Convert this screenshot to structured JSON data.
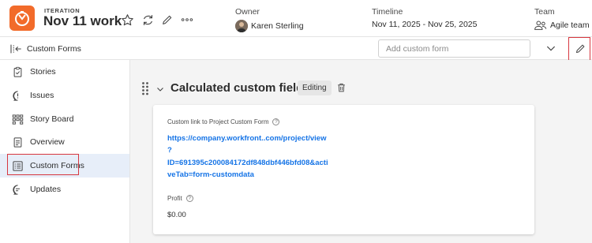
{
  "header": {
    "kicker": "ITERATION",
    "title": "Nov 11 work",
    "owner_label": "Owner",
    "owner_value": "Karen Sterling",
    "timeline_label": "Timeline",
    "timeline_value": "Nov 11, 2025 - Nov 25, 2025",
    "team_label": "Team",
    "team_value": "Agile team",
    "brand_color": "#f26b2a"
  },
  "subheader": {
    "title": "Custom Forms",
    "search_placeholder": "Add custom form"
  },
  "sidebar": {
    "items": [
      {
        "label": "Stories",
        "icon": "clipboard-icon"
      },
      {
        "label": "Issues",
        "icon": "issue-bubble-icon"
      },
      {
        "label": "Story Board",
        "icon": "board-grid-icon"
      },
      {
        "label": "Overview",
        "icon": "document-icon"
      },
      {
        "label": "Custom Forms",
        "icon": "form-list-icon",
        "active": true
      },
      {
        "label": "Updates",
        "icon": "chat-bubble-icon"
      }
    ]
  },
  "main": {
    "section_title": "Calculated custom fields",
    "status_badge": "Editing",
    "card": {
      "link_field_label": "Custom link to Project Custom Form",
      "link_lines": [
        "https://company.workfront..com/project/view",
        "?",
        "ID=691395c200084172df848dbf446bfd08&acti",
        "veTab=form-customdata"
      ],
      "profit_label": "Profit",
      "profit_value": "$0.00"
    }
  },
  "colors": {
    "accent_link": "#1473e6",
    "highlight": "#d7373f",
    "active_nav": "#e7eef9"
  }
}
